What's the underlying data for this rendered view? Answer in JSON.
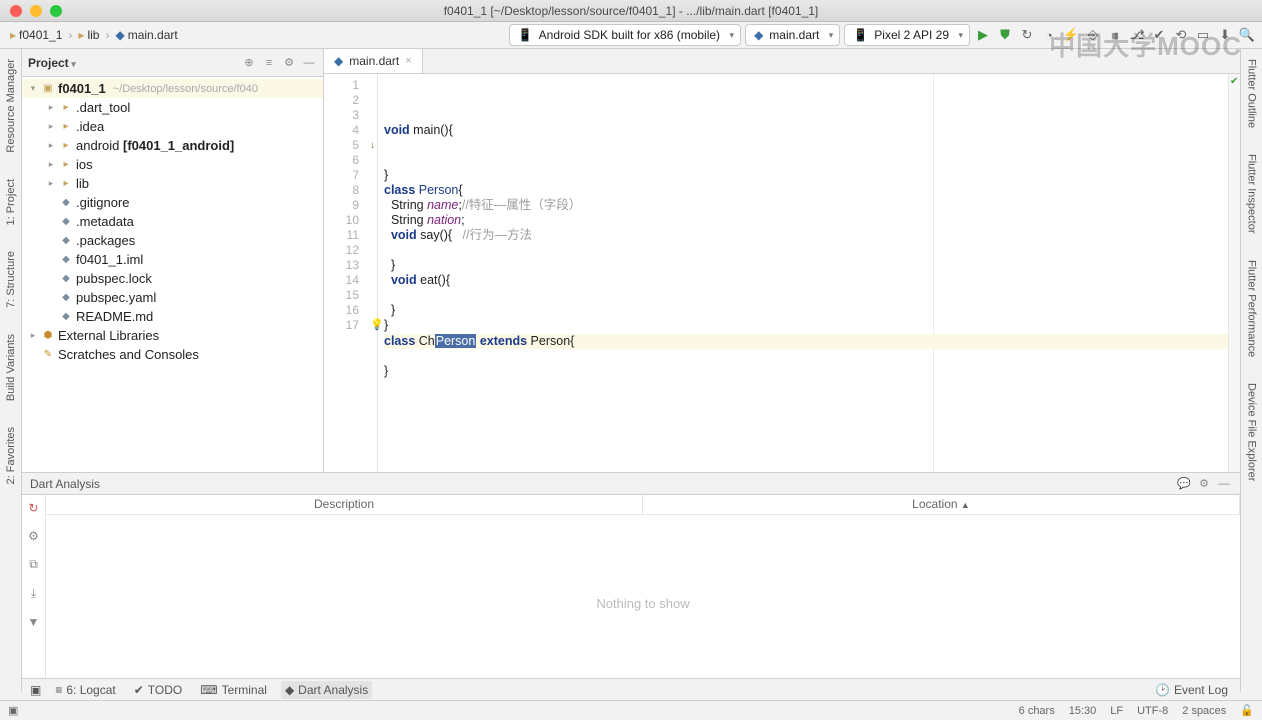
{
  "window_title": "f0401_1 [~/Desktop/lesson/source/f0401_1] - .../lib/main.dart [f0401_1]",
  "breadcrumb": {
    "project": "f0401_1",
    "folder": "lib",
    "file": "main.dart"
  },
  "toolbar": {
    "device": "Android SDK built for x86 (mobile)",
    "run_config": "main.dart",
    "emulator": "Pixel 2 API 29"
  },
  "watermark": "中国大学MOOC",
  "project_panel": {
    "title": "Project",
    "root": {
      "name": "f0401_1",
      "hint": "~/Desktop/lesson/source/f040"
    },
    "children": [
      {
        "name": ".dart_tool",
        "type": "folder"
      },
      {
        "name": ".idea",
        "type": "folder"
      },
      {
        "name": "android",
        "bold_suffix": " [f0401_1_android]",
        "type": "folder"
      },
      {
        "name": "ios",
        "type": "folder"
      },
      {
        "name": "lib",
        "type": "folder"
      },
      {
        "name": ".gitignore",
        "type": "file"
      },
      {
        "name": ".metadata",
        "type": "file"
      },
      {
        "name": ".packages",
        "type": "file"
      },
      {
        "name": "f0401_1.iml",
        "type": "file"
      },
      {
        "name": "pubspec.lock",
        "type": "file"
      },
      {
        "name": "pubspec.yaml",
        "type": "file"
      },
      {
        "name": "README.md",
        "type": "file"
      }
    ],
    "external": "External Libraries",
    "scratches": "Scratches and Consoles"
  },
  "editor": {
    "tab": "main.dart",
    "lines": [
      {
        "n": 1,
        "t": "void main(){",
        "kw": [
          "void"
        ]
      },
      {
        "n": 2,
        "t": ""
      },
      {
        "n": 3,
        "t": ""
      },
      {
        "n": 4,
        "t": "}"
      },
      {
        "n": 5,
        "t": "class Person{",
        "mark": true
      },
      {
        "n": 6,
        "t": "  String name;//特征—属性（字段）"
      },
      {
        "n": 7,
        "t": "  String nation;"
      },
      {
        "n": 8,
        "t": "  void say(){   //行为—方法"
      },
      {
        "n": 9,
        "t": ""
      },
      {
        "n": 10,
        "t": "  }"
      },
      {
        "n": 11,
        "t": "  void eat(){"
      },
      {
        "n": 12,
        "t": ""
      },
      {
        "n": 13,
        "t": "  }"
      },
      {
        "n": 14,
        "t": "}",
        "bulb": true
      },
      {
        "n": 15,
        "t": "class ChPerson extends Person{",
        "hl": true,
        "sel": "Person"
      },
      {
        "n": 16,
        "t": ""
      },
      {
        "n": 17,
        "t": "}"
      }
    ]
  },
  "left_tabs": [
    "Resource Manager",
    "1: Project",
    "7: Structure",
    "Build Variants",
    "2: Favorites"
  ],
  "right_tabs": [
    "Flutter Outline",
    "Flutter Inspector",
    "Flutter Performance",
    "Device File Explorer"
  ],
  "bottom_panel": {
    "title": "Dart Analysis",
    "columns": {
      "description": "Description",
      "location": "Location"
    },
    "empty": "Nothing to show"
  },
  "bottom_tools": {
    "logcat": "6: Logcat",
    "todo": "TODO",
    "terminal": "Terminal",
    "dart": "Dart Analysis",
    "eventlog": "Event Log"
  },
  "status": {
    "chars": "6 chars",
    "pos": "15:30",
    "le": "LF",
    "enc": "UTF-8",
    "indent": "2 spaces"
  }
}
